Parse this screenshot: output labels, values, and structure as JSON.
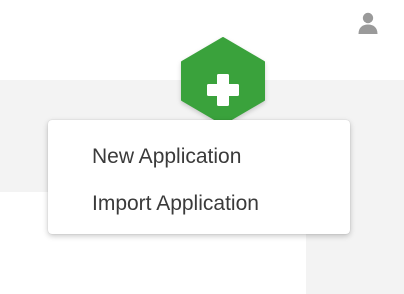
{
  "header": {
    "user_icon": "user-icon"
  },
  "add_button": {
    "icon": "plus-icon",
    "color": "#3aa23c"
  },
  "menu": {
    "items": [
      {
        "label": "New Application"
      },
      {
        "label": "Import Application"
      }
    ]
  }
}
